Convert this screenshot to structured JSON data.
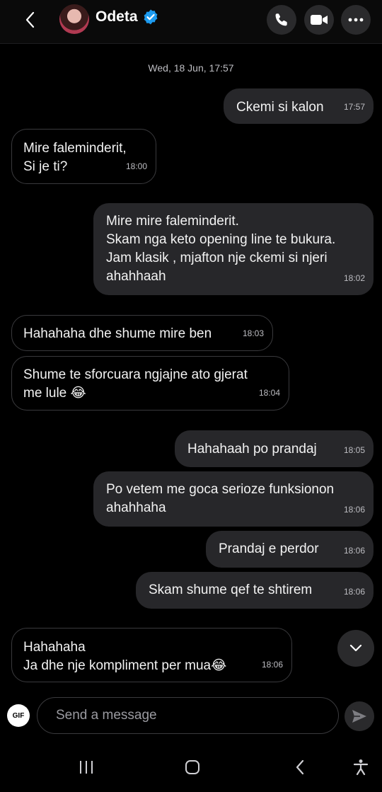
{
  "header": {
    "contact_name": "Odeta",
    "icons": [
      "chevron-left-icon",
      "avatar",
      "verified-badge-icon",
      "phone-icon",
      "video-icon",
      "more-horizontal-icon"
    ]
  },
  "thread": {
    "date_label": "Wed, 18 Jun, 17:57",
    "messages": [
      {
        "direction": "outgoing",
        "text": "Ckemi si kalon",
        "time": "17:57"
      },
      {
        "direction": "incoming",
        "text": "Mire faleminderit,\nSi je ti?",
        "time": "18:00"
      },
      {
        "direction": "outgoing",
        "text": "Mire mire faleminderit.\nSkam nga keto opening line te bukura.\nJam klasik , mjafton nje ckemi si njeri\nahahhaah",
        "time": "18:02"
      },
      {
        "direction": "incoming",
        "text": "Hahahaha dhe shume mire ben",
        "time": "18:03"
      },
      {
        "direction": "incoming",
        "text": "Shume te sforcuara ngjajne ato gjerat\nme lule 😂",
        "time": "18:04"
      },
      {
        "direction": "outgoing",
        "text": "Hahahaah po prandaj",
        "time": "18:05"
      },
      {
        "direction": "outgoing",
        "text": "Po vetem me goca serioze funksionon\nahahhaha",
        "time": "18:06"
      },
      {
        "direction": "outgoing",
        "text": "Prandaj e perdor",
        "time": "18:06"
      },
      {
        "direction": "outgoing",
        "text": "Skam shume qef te shtirem",
        "time": "18:06"
      },
      {
        "direction": "incoming",
        "text": "Hahahaha\nJa dhe nje kompliment per mua😂",
        "time": "18:06"
      }
    ]
  },
  "composer": {
    "gif_label": "GIF",
    "placeholder": "Send a message"
  },
  "colors": {
    "background": "#000000",
    "outgoing_bubble": "#27272a",
    "incoming_border": "#3a3a3d",
    "verified_blue": "#1d9bf0"
  }
}
